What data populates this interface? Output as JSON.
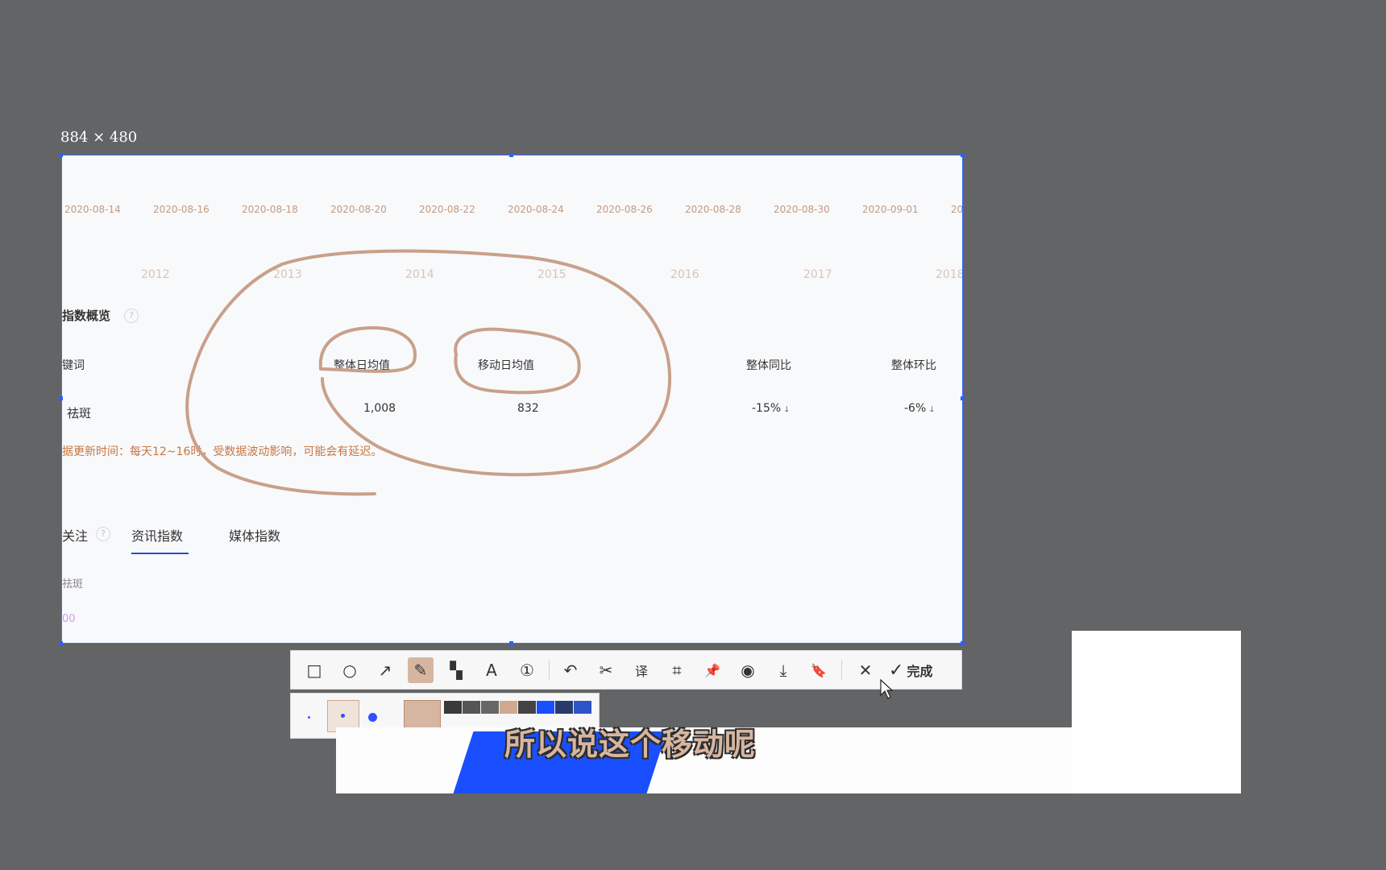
{
  "selection": {
    "size_label": "884 × 480"
  },
  "timeline": {
    "dates": [
      "2020-08-14",
      "2020-08-16",
      "2020-08-18",
      "2020-08-20",
      "2020-08-22",
      "2020-08-24",
      "2020-08-26",
      "2020-08-28",
      "2020-08-30",
      "2020-09-01",
      "20"
    ],
    "years": [
      "2012",
      "2013",
      "2014",
      "2015",
      "2016",
      "2017",
      "2018"
    ]
  },
  "overview": {
    "title": "指数概览",
    "help_icon": "?",
    "columns": [
      "键词",
      "整体日均值",
      "移动日均值",
      "整体同比",
      "整体环比"
    ],
    "row": {
      "keyword": "祛斑",
      "overall_daily_avg": "1,008",
      "mobile_daily_avg": "832",
      "overall_yoy": "-15%",
      "overall_mom": "-6%",
      "trend_icon": "🡓"
    },
    "update_note": "据更新时间：每天12~16时，受数据波动影响，可能会有延迟。"
  },
  "tabs": {
    "attention_label": "关注",
    "items": [
      "资讯指数",
      "媒体指数"
    ],
    "active_index": 0
  },
  "chart_area": {
    "keyword_label": "祛斑",
    "axis_value": "00"
  },
  "toolbar": {
    "tools": [
      {
        "name": "rectangle-icon",
        "glyph": "□"
      },
      {
        "name": "circle-icon",
        "glyph": "○"
      },
      {
        "name": "arrow-icon",
        "glyph": "↗"
      },
      {
        "name": "pencil-icon",
        "glyph": "✎"
      },
      {
        "name": "mosaic-icon",
        "glyph": "▚"
      },
      {
        "name": "text-icon",
        "glyph": "A"
      },
      {
        "name": "number-icon",
        "glyph": "①"
      },
      {
        "name": "undo-icon",
        "glyph": "↶"
      },
      {
        "name": "scissors-icon",
        "glyph": "✂"
      },
      {
        "name": "translate-icon",
        "glyph": "译"
      },
      {
        "name": "ocr-icon",
        "glyph": "⌗"
      },
      {
        "name": "pin-icon",
        "glyph": "📌"
      },
      {
        "name": "record-icon",
        "glyph": "◉"
      },
      {
        "name": "download-icon",
        "glyph": "⤓"
      },
      {
        "name": "bookmark-icon",
        "glyph": "🔖"
      },
      {
        "name": "close-icon",
        "glyph": "✕"
      }
    ],
    "done_check": "✓",
    "done_label": "完成"
  },
  "palette": {
    "current": "#d7b6a1",
    "swatches": [
      "#3a3a3a",
      "#555555",
      "#666666",
      "#cfa98f",
      "#444444",
      "#1a4fff",
      "#2a3a6a",
      "#2d55c8"
    ]
  },
  "subtitle": "所以说这个移动呢"
}
